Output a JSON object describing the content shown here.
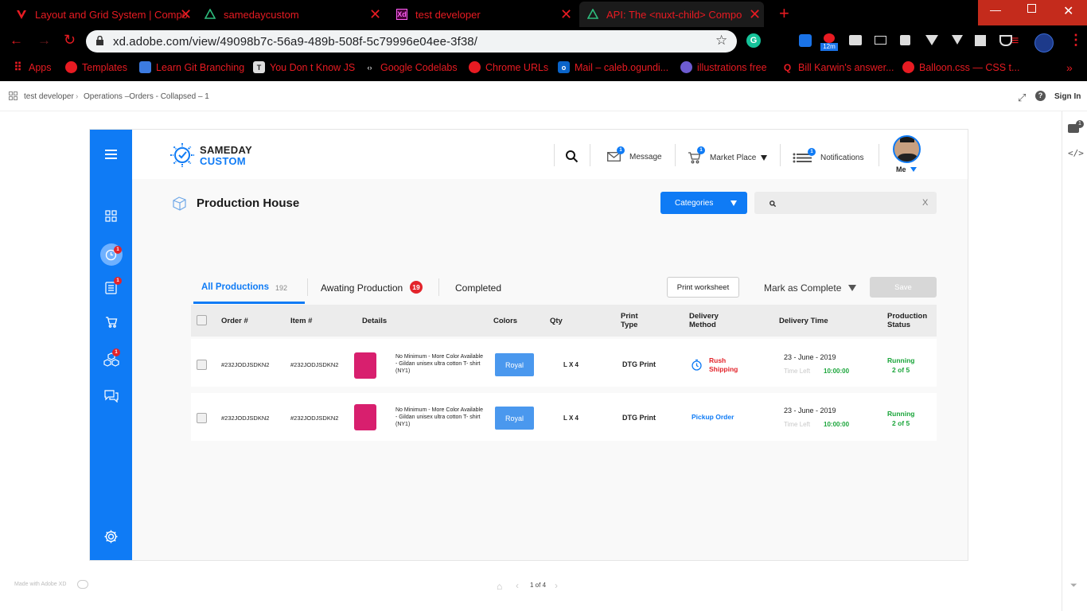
{
  "browser": {
    "tabs": [
      {
        "title": "Layout and Grid System | Compo",
        "icon": "vuetify-icon"
      },
      {
        "title": "samedaycustom",
        "icon": "nuxt-icon"
      },
      {
        "title": "test developer",
        "icon": "adobe-xd-icon"
      },
      {
        "title": "API: The <nuxt-child> Componen",
        "icon": "nuxt-icon"
      }
    ],
    "url": "xd.adobe.com/view/49098b7c-56a9-489b-508f-5c79996e04ee-3f38/",
    "badge_12m": "12m",
    "bookmarks": [
      "Apps",
      "Templates",
      "Learn Git Branching",
      "You Don t Know JS",
      "Google Codelabs",
      "Chrome URLs",
      "Mail – caleb.ogundi...",
      "illustrations free",
      "Bill Karwin's answer...",
      "Balloon.css — CSS t..."
    ]
  },
  "xd": {
    "crumb_project": "test developer",
    "crumb_page": "Operations –Orders - Collapsed – 1",
    "sign_in": "Sign In",
    "comment_badge": "1",
    "made_with": "Made with Adobe XD",
    "page_counter": "1 of 4"
  },
  "app": {
    "logo_top": "SAMEDAY",
    "logo_bottom": "CUSTOM",
    "header": {
      "message": "Message",
      "market_place": "Market Place",
      "notifications": "Notifications",
      "me": "Me",
      "badge_message": "1",
      "badge_market": "1",
      "badge_notif": "1"
    },
    "sidebar_badges": {
      "clock": "1",
      "list": "1",
      "cubes": "1"
    },
    "page_title": "Production House",
    "categories_label": "Categories",
    "search_clear": "X",
    "tabs": {
      "all": "All Productions",
      "all_count": "192",
      "awaiting": "Awating  Production",
      "awaiting_count": "19",
      "completed": "Completed"
    },
    "print_worksheet": "Print worksheet",
    "mark_complete": "Mark as Complete",
    "save": "Save",
    "columns": {
      "order": "Order #",
      "item": "Item #",
      "details": "Details",
      "colors": "Colors",
      "qty": "Qty",
      "print_type": "Print Type",
      "delivery_method": "Delivery Method",
      "delivery_time": "Delivery Time",
      "production_status": "Production Status"
    },
    "rows": [
      {
        "order": "#232JODJSDKN2",
        "item": "#232JODJSDKN2",
        "details": "No Minimum - More Color Available - Gildan unisex ultra cotton T- shirt (NY1)",
        "color": "Royal",
        "qty": "L X 4",
        "print_type": "DTG Print",
        "delivery": "Rush Shipping",
        "date": "23 - June - 2019",
        "time_left_label": "Time Left",
        "time_left": "10:00:00",
        "status": "Running",
        "status_progress": "2 of 5"
      },
      {
        "order": "#232JODJSDKN2",
        "item": "#232JODJSDKN2",
        "details": "No Minimum - More Color Available - Gildan unisex ultra cotton T- shirt (NY1)",
        "color": "Royal",
        "qty": "L X 4",
        "print_type": "DTG Print",
        "delivery": "Pickup Order",
        "date": "23 - June - 2019",
        "time_left_label": "Time Left",
        "time_left": "10:00:00",
        "status": "Running",
        "status_progress": "2 of 5"
      }
    ]
  },
  "colors": {
    "brand_blue": "#0f7bf5",
    "alert_red": "#e3242b",
    "running_green": "#1aa53a",
    "browser_red": "#e81b22"
  }
}
